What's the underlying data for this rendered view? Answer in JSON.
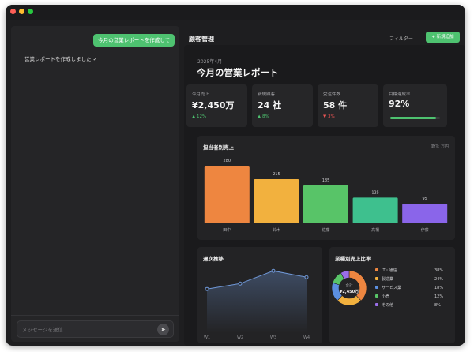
{
  "chat": {
    "user_message": "今月の営業レポートを作成して",
    "assistant_message": "営業レポートを作成しました ✓",
    "input_placeholder": "メッセージを送信...",
    "send_icon": "send-icon"
  },
  "header": {
    "title": "顧客管理",
    "filter_label": "フィルター",
    "new_label": "+ 新規追加"
  },
  "report": {
    "date": "2025年4月",
    "title": "今月の営業レポート"
  },
  "kpis": [
    {
      "label": "今月売上",
      "value": "¥2,450万",
      "change": "▲ 12%",
      "trend": "up"
    },
    {
      "label": "新規顧客",
      "value": "24 社",
      "change": "▲ 8%",
      "trend": "up"
    },
    {
      "label": "受注件数",
      "value": "58 件",
      "change": "▼ 3%",
      "trend": "down"
    },
    {
      "label": "目標達成率",
      "value": "92%",
      "progress": 0.92
    }
  ],
  "colors": {
    "accent": "#4ec270",
    "down": "#ee5555",
    "bars": [
      "#ee8640",
      "#f2b13e",
      "#58c468",
      "#3ec08e",
      "#8a65ea"
    ],
    "line": "#6f97d6"
  },
  "chart_data": [
    {
      "type": "bar",
      "title": "担当者別売上",
      "unit": "単位: 万円",
      "categories": [
        "田中",
        "鈴木",
        "佐藤",
        "高橋",
        "伊藤"
      ],
      "values": [
        280,
        215,
        185,
        125,
        95
      ],
      "ylim": [
        0,
        300
      ],
      "grid": false
    },
    {
      "type": "line",
      "title": "週次推移",
      "x": [
        "W1",
        "W2",
        "W3",
        "W4"
      ],
      "values": [
        520,
        580,
        720,
        650
      ],
      "ylim": [
        0,
        800
      ],
      "grid": false
    },
    {
      "type": "pie",
      "title": "業種別売上比率",
      "center_label": "合計",
      "center_value": "¥2,450万",
      "legend_position": "right",
      "slices": [
        {
          "label": "IT・通信",
          "value": 38,
          "display": "38%",
          "color": "#ee8640"
        },
        {
          "label": "製造業",
          "value": 24,
          "display": "24%",
          "color": "#f2b13e"
        },
        {
          "label": "サービス業",
          "value": 18,
          "display": "18%",
          "color": "#5b8fe0"
        },
        {
          "label": "小売",
          "value": 12,
          "display": "12%",
          "color": "#58c468"
        },
        {
          "label": "その他",
          "value": 8,
          "display": "8%",
          "color": "#9a6ee8"
        }
      ]
    }
  ]
}
